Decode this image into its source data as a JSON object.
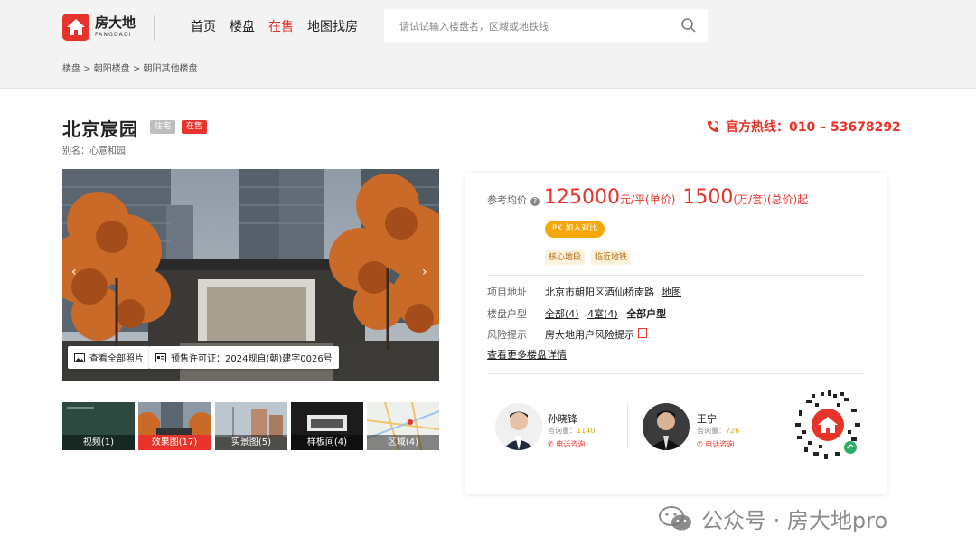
{
  "header": {
    "logo_cn": "房大地",
    "logo_en": "FANGDADI",
    "nav": [
      "首页",
      "楼盘",
      "在售",
      "地图找房"
    ],
    "nav_active": "在售",
    "search_placeholder": "请试试输入楼盘名，区域或地铁线"
  },
  "breadcrumb": "楼盘 > 朝阳楼盘 > 朝阳其他楼盘",
  "project": {
    "name": "北京宸园",
    "tags": [
      "住宅",
      "在售"
    ],
    "alias": "别名：心意和园",
    "hotline": "官方热线：010 – 53678292"
  },
  "gallery": {
    "all_photos": "查看全部照片",
    "permit": "预售许可证：2024规自(朝)建字0026号",
    "thumbs": [
      "视频(1)",
      "效果图(17)",
      "实景图(5)",
      "样板间(4)",
      "区域(4)"
    ],
    "active_thumb": 1
  },
  "price": {
    "label": "参考均价",
    "unit_price": "125000",
    "unit_price_suffix": "元/平(单价)",
    "total_price": "1500",
    "total_price_suffix": "(万/套)(总价)起",
    "pk_button": "PK 加入对比",
    "features": [
      "核心地段",
      "临近地铁"
    ]
  },
  "details": {
    "address_label": "项目地址",
    "address": "北京市朝阳区酒仙桥南路",
    "map_link": "地图",
    "layout_label": "楼盘户型",
    "layout_all": "全部(4)",
    "layout_4room": "4室(4)",
    "layout_alltypes": "全部户型",
    "risk_label": "风险提示",
    "risk_text": "房大地用户风险提示",
    "more_link": "查看更多楼盘详情"
  },
  "agents": [
    {
      "name": "孙晓锋",
      "consult_label": "咨询量：",
      "consult_count": "1140",
      "call": "电话咨询"
    },
    {
      "name": "王宁",
      "consult_label": "咨询量：",
      "consult_count": "726",
      "call": "电话咨询"
    }
  ],
  "watermark": "公众号 · 房大地pro",
  "colors": {
    "brand": "#e8332a",
    "pk": "#f4a80d"
  }
}
